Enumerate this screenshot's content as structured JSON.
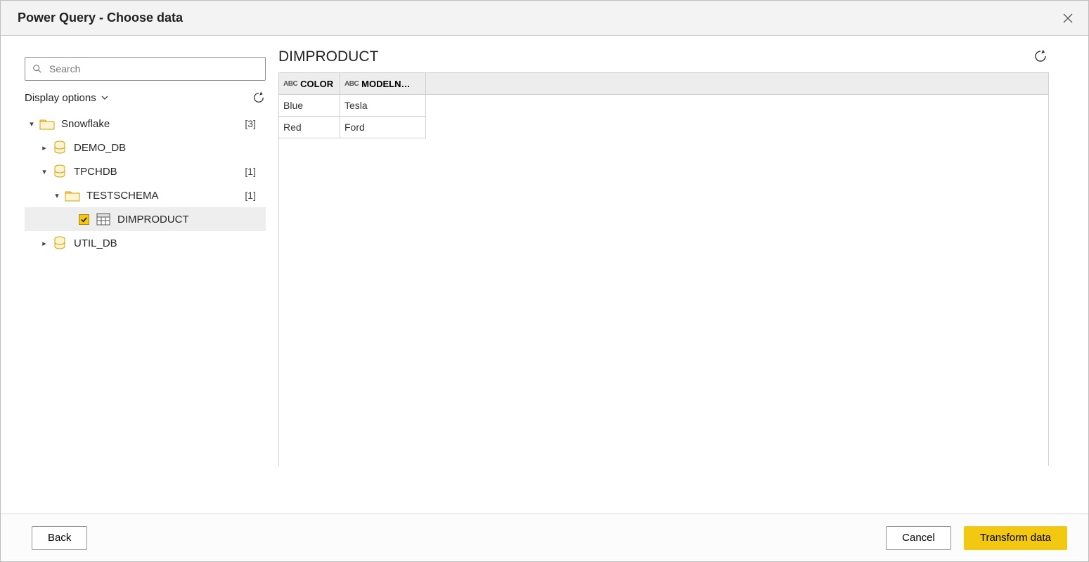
{
  "window": {
    "title": "Power Query - Choose data"
  },
  "sidebar": {
    "search_placeholder": "Search",
    "display_options_label": "Display options",
    "tree": {
      "root": {
        "label": "Snowflake",
        "count": "[3]"
      },
      "demo_db": {
        "label": "DEMO_DB"
      },
      "tpchdb": {
        "label": "TPCHDB",
        "count": "[1]"
      },
      "testschema": {
        "label": "TESTSCHEMA",
        "count": "[1]"
      },
      "dimproduct": {
        "label": "DIMPRODUCT"
      },
      "util_db": {
        "label": "UTIL_DB"
      }
    }
  },
  "preview": {
    "title": "DIMPRODUCT",
    "columns": {
      "c1": "COLOR",
      "c2": "MODELN…"
    },
    "rows": [
      {
        "c1": "Blue",
        "c2": "Tesla"
      },
      {
        "c1": "Red",
        "c2": "Ford"
      }
    ]
  },
  "footer": {
    "back": "Back",
    "cancel": "Cancel",
    "transform": "Transform data"
  },
  "icons": {
    "abc": "ABC"
  }
}
